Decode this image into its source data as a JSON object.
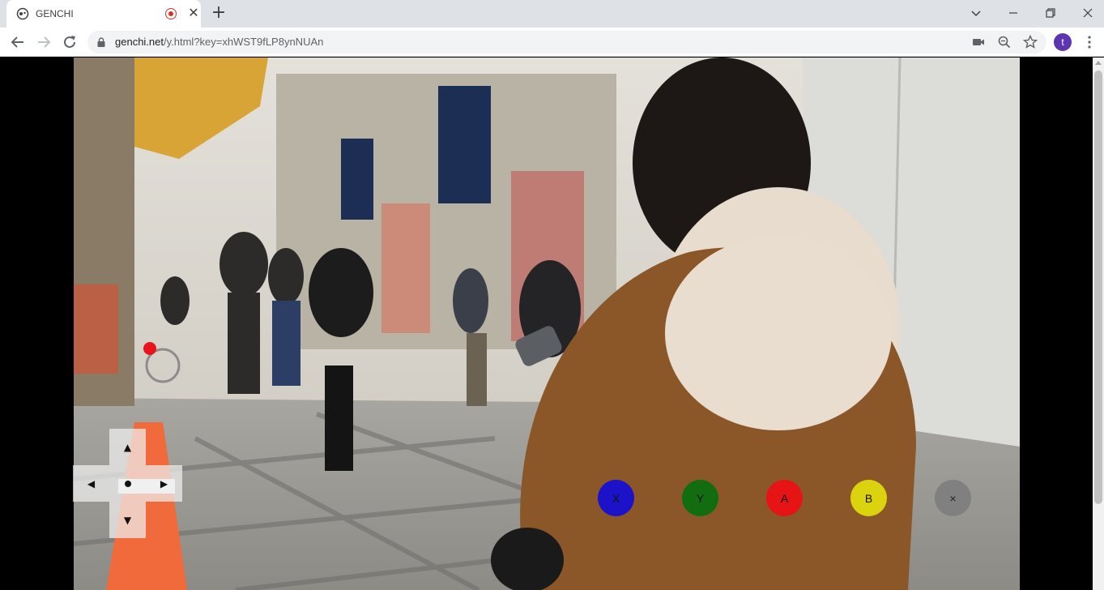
{
  "browser": {
    "tab": {
      "title": "GENCHI",
      "close_glyph": "✕",
      "favicon": "genchi-logo-icon",
      "recording": true
    },
    "new_tab_glyph": "+",
    "url_host": "genchi.net",
    "url_path": "/y.html?key=xhWST9fLP8ynNUAn",
    "profile_initial": "t",
    "icons": [
      "back-icon",
      "forward-icon",
      "reload-icon",
      "lock-icon",
      "camera-icon",
      "zoom-icon",
      "star-icon",
      "menu-icon"
    ]
  },
  "controller": {
    "dpad": {
      "up": "▲",
      "down": "▼",
      "left": "◀",
      "right": "▶"
    },
    "buttons": [
      {
        "key": "x",
        "label": "X",
        "color": "#1b12c9"
      },
      {
        "key": "y",
        "label": "Y",
        "color": "#116d10"
      },
      {
        "key": "a",
        "label": "A",
        "color": "#e61414"
      },
      {
        "key": "b",
        "label": "B",
        "color": "#dcd30f"
      },
      {
        "key": "close",
        "label": "×",
        "color": "#808080"
      }
    ]
  },
  "colors": {
    "tabstrip": "#dee1e6",
    "omnibox": "#f1f3f4",
    "profile": "#5e35b1",
    "pointer": "#e8141a"
  }
}
